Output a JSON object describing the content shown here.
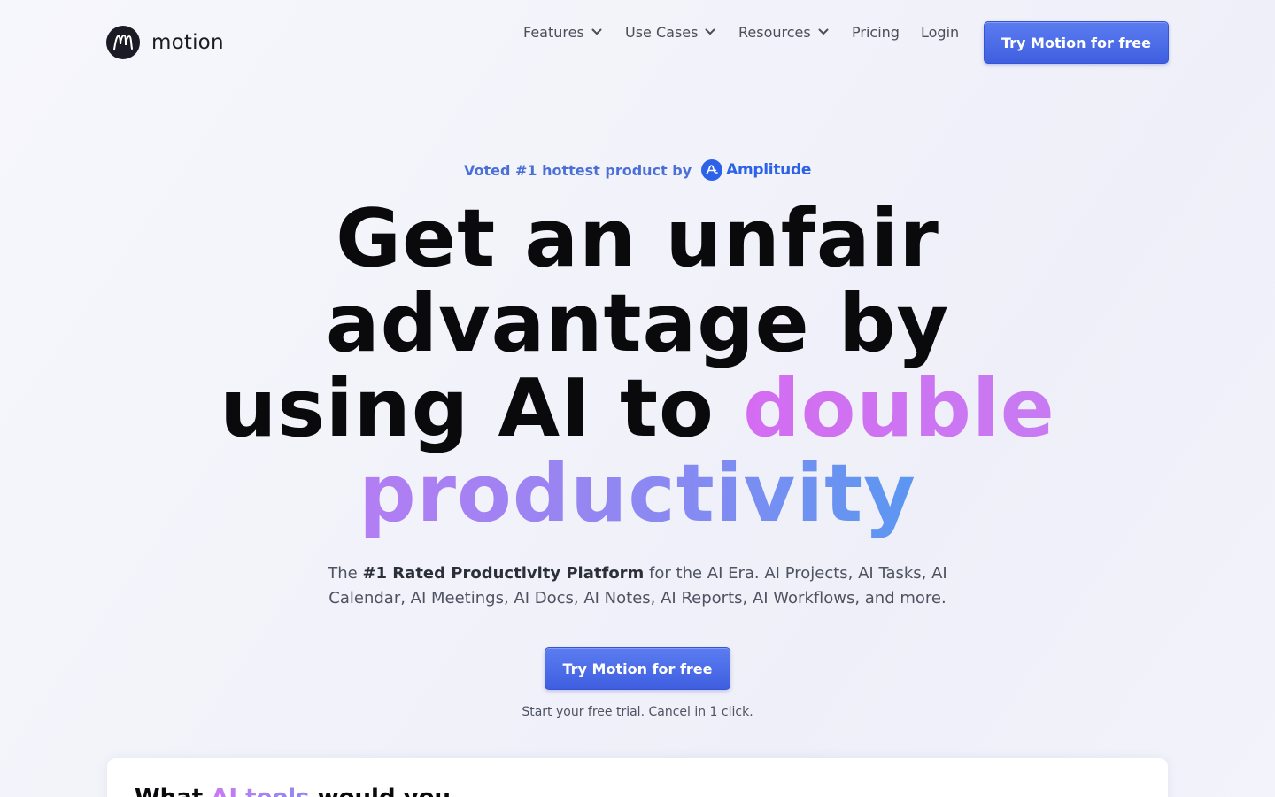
{
  "brand": {
    "name": "motion"
  },
  "nav": {
    "items": [
      {
        "label": "Features",
        "has_dropdown": true
      },
      {
        "label": "Use Cases",
        "has_dropdown": true
      },
      {
        "label": "Resources",
        "has_dropdown": true
      },
      {
        "label": "Pricing",
        "has_dropdown": false
      },
      {
        "label": "Login",
        "has_dropdown": false
      }
    ],
    "cta_label": "Try Motion for free"
  },
  "hero": {
    "voted_text": "Voted #1 hottest product by",
    "voted_brand": "Amplitude",
    "headline_line1": "Get an unfair",
    "headline_line2": "advantage by",
    "headline_line3_a": "using AI to ",
    "headline_line3_b": "double",
    "headline_line4": "productivity",
    "sub_prefix": "The ",
    "sub_bold": "#1 Rated Productivity Platform",
    "sub_suffix": " for the AI Era. AI Projects, AI Tasks, AI Calendar, AI Meetings, AI Docs, AI Notes, AI Reports, AI Workflows, and more.",
    "cta_label": "Try Motion for free",
    "trial_note": "Start your free trial. Cancel in 1 click."
  },
  "card": {
    "title_a": "What ",
    "title_ai": "AI tools",
    "title_b": " would you"
  },
  "colors": {
    "accent": "#4a6be6",
    "voted": "#4a6fd6",
    "amplitude": "#2c62e8",
    "gradient_pink": "#d46cf1",
    "gradient_blue": "#5a97f1"
  }
}
